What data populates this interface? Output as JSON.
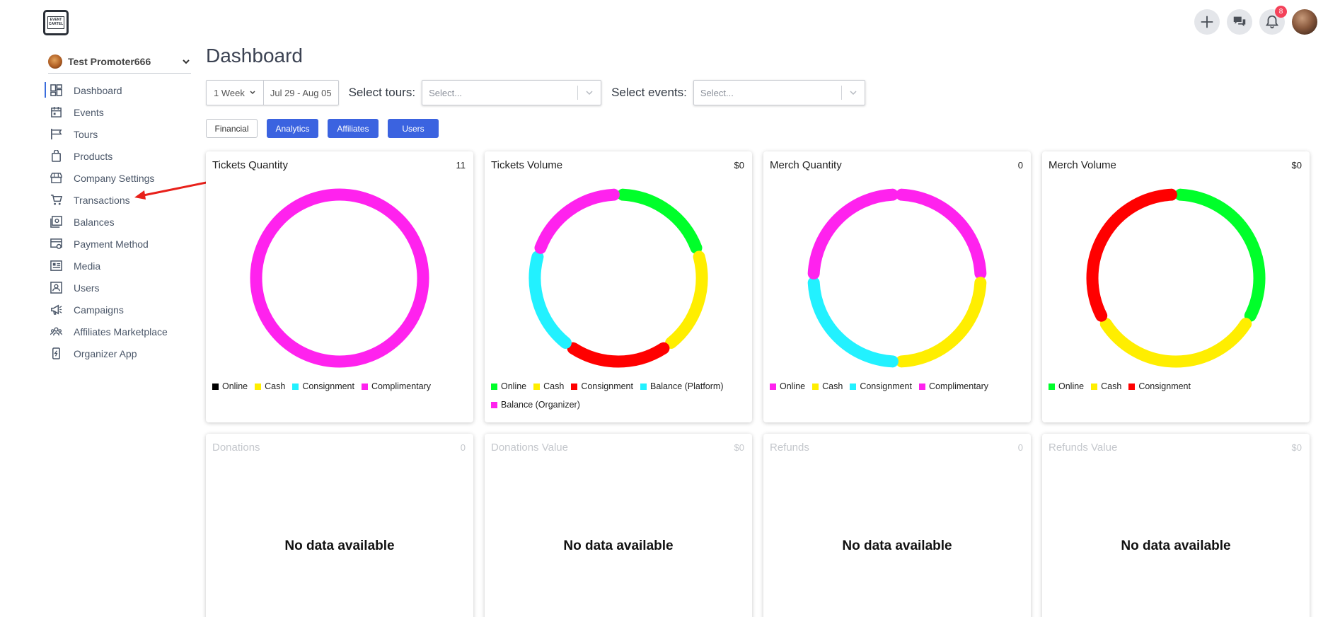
{
  "logo": {
    "text": "EVENT CARTEL"
  },
  "topbar": {
    "notifications_count": "8"
  },
  "organizer": {
    "name": "Test Promoter666"
  },
  "sidebar": {
    "items": [
      {
        "label": "Dashboard",
        "icon": "dashboard-icon",
        "active": true
      },
      {
        "label": "Events",
        "icon": "calendar-icon"
      },
      {
        "label": "Tours",
        "icon": "flag-icon"
      },
      {
        "label": "Products",
        "icon": "bag-icon"
      },
      {
        "label": "Company Settings",
        "icon": "store-icon"
      },
      {
        "label": "Transactions",
        "icon": "cart-icon"
      },
      {
        "label": "Balances",
        "icon": "money-icon"
      },
      {
        "label": "Payment Method",
        "icon": "card-gear-icon"
      },
      {
        "label": "Media",
        "icon": "media-icon"
      },
      {
        "label": "Users",
        "icon": "user-id-icon"
      },
      {
        "label": "Campaigns",
        "icon": "megaphone-icon"
      },
      {
        "label": "Affiliates Marketplace",
        "icon": "group-icon"
      },
      {
        "label": "Organizer App",
        "icon": "phone-icon"
      }
    ]
  },
  "page": {
    "title": "Dashboard"
  },
  "filters": {
    "period": "1 Week",
    "date_range": "Jul 29 - Aug 05",
    "tours_label": "Select tours:",
    "tours_placeholder": "Select...",
    "events_label": "Select events:",
    "events_placeholder": "Select..."
  },
  "tabs": [
    "Financial",
    "Analytics",
    "Affiliates",
    "Users"
  ],
  "colors": {
    "online": "#00ff2a",
    "cash": "#ffee00",
    "consignment": "#ff0000",
    "cyan": "#22f1ff",
    "magenta": "#ff22ee",
    "online_black": "#000000",
    "accent": "#3b63e0"
  },
  "chart_data": [
    {
      "type": "pie",
      "title": "Tickets Quantity",
      "total": "11",
      "legend": [
        {
          "name": "Online",
          "color": "#000000"
        },
        {
          "name": "Cash",
          "color": "#ffee00"
        },
        {
          "name": "Consignment",
          "color": "#22f1ff"
        },
        {
          "name": "Complimentary",
          "color": "#ff22ee"
        }
      ],
      "slices": [
        {
          "name": "Complimentary",
          "value": 100,
          "color": "#ff22ee"
        }
      ]
    },
    {
      "type": "pie",
      "title": "Tickets Volume",
      "total": "$0",
      "legend": [
        {
          "name": "Online",
          "color": "#00ff2a"
        },
        {
          "name": "Cash",
          "color": "#ffee00"
        },
        {
          "name": "Consignment",
          "color": "#ff0000"
        },
        {
          "name": "Balance (Platform)",
          "color": "#22f1ff"
        },
        {
          "name": "Balance (Organizer)",
          "color": "#ff22ee"
        }
      ],
      "slices": [
        {
          "name": "Online",
          "value": 20,
          "color": "#00ff2a"
        },
        {
          "name": "Cash",
          "value": 20,
          "color": "#ffee00"
        },
        {
          "name": "Consignment",
          "value": 20,
          "color": "#ff0000"
        },
        {
          "name": "Balance (Platform)",
          "value": 20,
          "color": "#22f1ff"
        },
        {
          "name": "Balance (Organizer)",
          "value": 20,
          "color": "#ff22ee"
        }
      ]
    },
    {
      "type": "pie",
      "title": "Merch Quantity",
      "total": "0",
      "legend": [
        {
          "name": "Online",
          "color": "#ff22ee"
        },
        {
          "name": "Cash",
          "color": "#ffee00"
        },
        {
          "name": "Consignment",
          "color": "#22f1ff"
        },
        {
          "name": "Complimentary",
          "color": "#ff22ee"
        }
      ],
      "slices": [
        {
          "name": "Online",
          "value": 25,
          "color": "#ff22ee"
        },
        {
          "name": "Cash",
          "value": 25,
          "color": "#ffee00"
        },
        {
          "name": "Consignment",
          "value": 25,
          "color": "#22f1ff"
        },
        {
          "name": "Complimentary",
          "value": 25,
          "color": "#ff22ee"
        }
      ]
    },
    {
      "type": "pie",
      "title": "Merch Volume",
      "total": "$0",
      "legend": [
        {
          "name": "Online",
          "color": "#00ff2a"
        },
        {
          "name": "Cash",
          "color": "#ffee00"
        },
        {
          "name": "Consignment",
          "color": "#ff0000"
        }
      ],
      "slices": [
        {
          "name": "Online",
          "value": 33.33,
          "color": "#00ff2a"
        },
        {
          "name": "Cash",
          "value": 33.33,
          "color": "#ffee00"
        },
        {
          "name": "Consignment",
          "value": 33.33,
          "color": "#ff0000"
        }
      ]
    }
  ],
  "empty_cards": [
    {
      "title": "Donations",
      "value": "0",
      "message": "No data available"
    },
    {
      "title": "Donations Value",
      "value": "$0",
      "message": "No data available"
    },
    {
      "title": "Refunds",
      "value": "0",
      "message": "No data available"
    },
    {
      "title": "Refunds Value",
      "value": "$0",
      "message": "No data available"
    }
  ]
}
